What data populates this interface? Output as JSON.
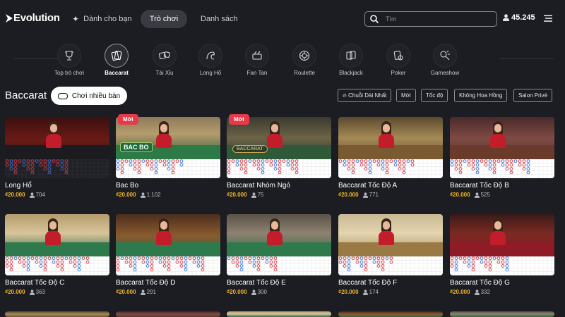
{
  "header": {
    "logo": "Evolution",
    "nav": {
      "for_you": "Dành cho bạn",
      "games": "Trò chơi",
      "list": "Danh sách"
    },
    "search_placeholder": "Tìm",
    "balance": "45.245"
  },
  "categories": [
    {
      "label": "Top trò chơi",
      "icon": "trophy-icon",
      "active": false
    },
    {
      "label": "Baccarat",
      "icon": "baccarat-cards-icon",
      "active": true
    },
    {
      "label": "Tài Xỉu",
      "icon": "dice-icon",
      "active": false
    },
    {
      "label": "Long Hổ",
      "icon": "dragon-tiger-icon",
      "active": false
    },
    {
      "label": "Fan Tan",
      "icon": "fan-tan-icon",
      "active": false
    },
    {
      "label": "Roulette",
      "icon": "roulette-icon",
      "active": false
    },
    {
      "label": "Blackjack",
      "icon": "blackjack-icon",
      "active": false
    },
    {
      "label": "Poker",
      "icon": "poker-icon",
      "active": false
    },
    {
      "label": "Gameshow",
      "icon": "gameshow-icon",
      "active": false
    }
  ],
  "section": {
    "title": "Baccarat",
    "multi_button": "Chơi nhiều bàn",
    "filters": [
      "Chuỗi Dài Nhất",
      "Mới",
      "Tốc độ",
      "Không Hoa Hồng",
      "Salon Privé"
    ]
  },
  "badge_new_label": "Mới",
  "games": [
    {
      "title": "Long Hổ",
      "price": "₫20.000",
      "players": "704",
      "new": false
    },
    {
      "title": "Bac Bo",
      "price": "₫20.000",
      "players": "1.102",
      "new": true,
      "logo": "BAC BO"
    },
    {
      "title": "Baccarat Nhóm Ngó",
      "price": "₫20.000",
      "players": "75",
      "new": true,
      "logo": "BACCARAT"
    },
    {
      "title": "Baccarat Tốc Độ A",
      "price": "₫20.000",
      "players": "771",
      "new": false
    },
    {
      "title": "Baccarat Tốc Độ B",
      "price": "₫20.000",
      "players": "525",
      "new": false
    },
    {
      "title": "Baccarat Tốc Độ C",
      "price": "₫20.000",
      "players": "363",
      "new": false
    },
    {
      "title": "Baccarat Tốc Độ D",
      "price": "₫20.000",
      "players": "291",
      "new": false
    },
    {
      "title": "Baccarat Tốc Độ E",
      "price": "₫20.000",
      "players": "300",
      "new": false
    },
    {
      "title": "Baccarat Tốc Độ F",
      "price": "₫20.000",
      "players": "174",
      "new": false
    },
    {
      "title": "Baccarat Tốc Độ G",
      "price": "₫20.000",
      "players": "332",
      "new": false
    }
  ],
  "colors": {
    "accent_yellow": "#f1b62b",
    "badge_red": "#e63a4b",
    "background": "#1c1d22"
  }
}
